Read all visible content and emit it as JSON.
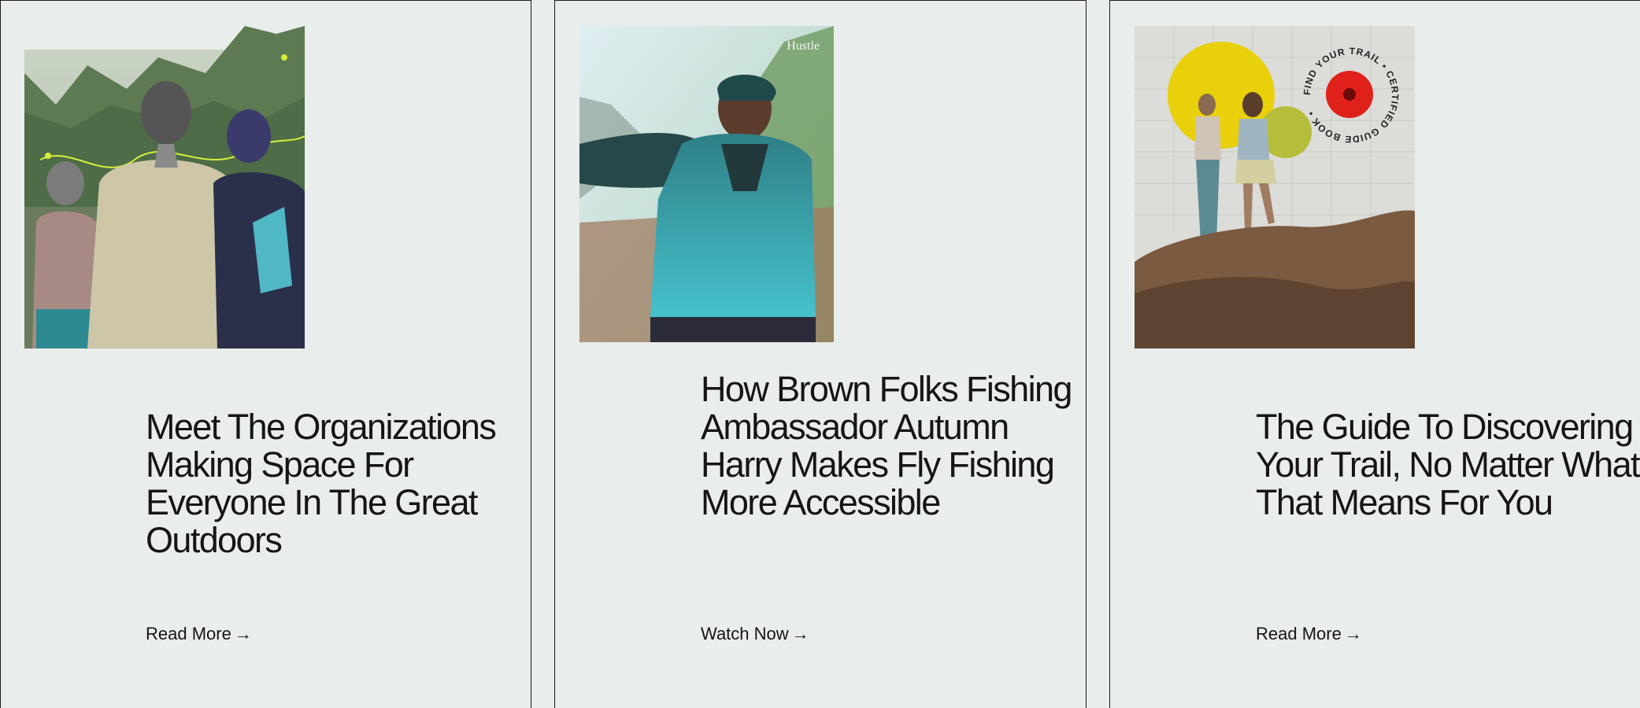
{
  "cards": [
    {
      "title": "Meet The Organizations Making Space For Everyone In The Great Outdoors",
      "cta": "Read More",
      "arrow": "→",
      "image_icon": "hikers-group-photo"
    },
    {
      "title": "How Brown Folks Fishing Ambassador Autumn Harry Makes Fly Fishing More Accessible",
      "cta": "Watch Now",
      "arrow": "→",
      "image_icon": "video-still-photo",
      "image_watermark": "Hustle"
    },
    {
      "title": "The Guide To Discovering Your Trail, No Matter What That Means For You",
      "cta": "Read More",
      "arrow": "→",
      "image_icon": "guidebook-collage-photo",
      "badge_text": "FIND YOUR TRAIL • CERTIFIED GUIDE BOOK •"
    }
  ],
  "colors": {
    "background": "#e9edeb",
    "text": "#151515",
    "border": "#1c1c1c",
    "accent_yellow": "#e8d00a",
    "accent_red": "#e0201a",
    "accent_teal": "#3cb9c4"
  }
}
